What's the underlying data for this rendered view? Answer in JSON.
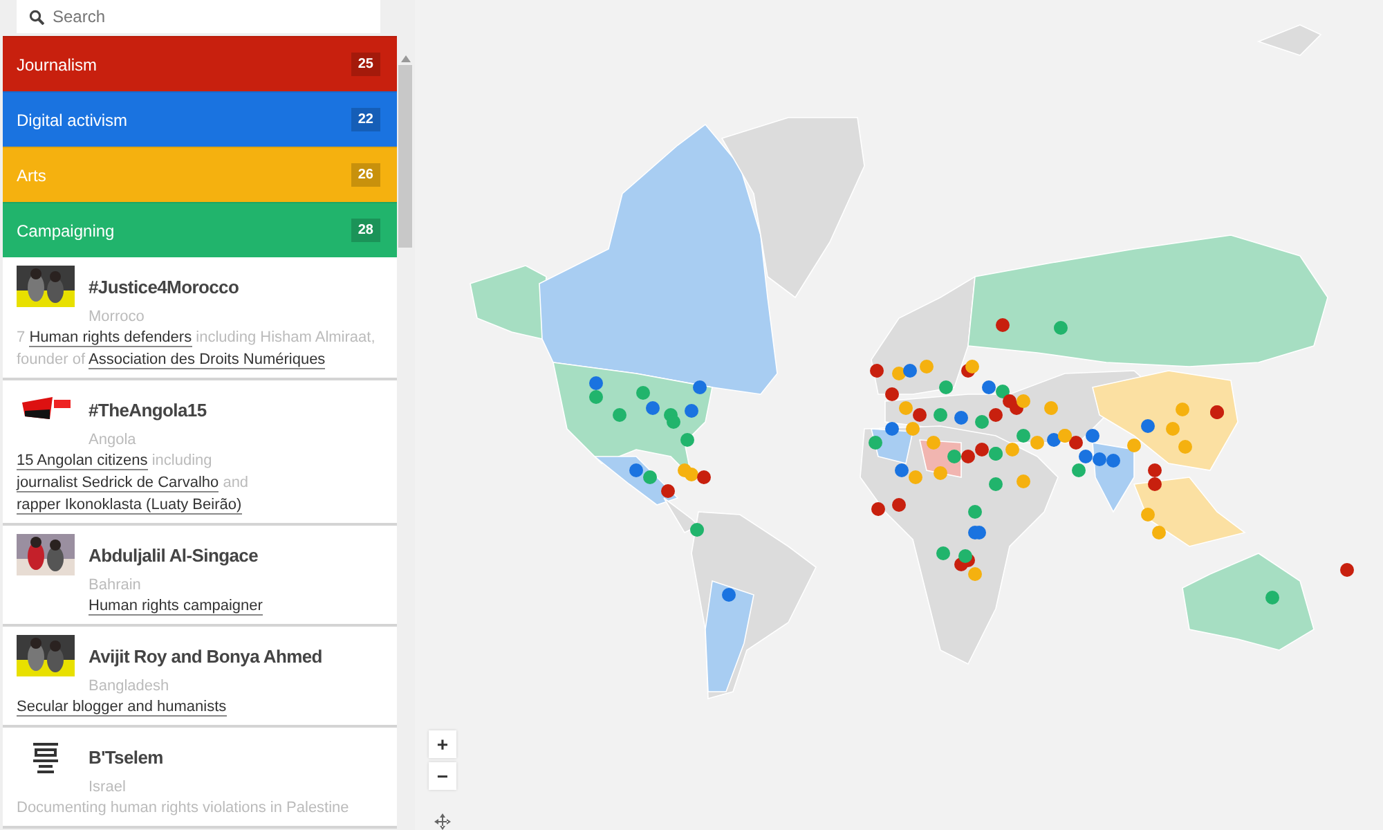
{
  "search": {
    "placeholder": "Search"
  },
  "categories": [
    {
      "label": "Journalism",
      "count": "25",
      "color": "#c8200e"
    },
    {
      "label": "Digital activism",
      "count": "22",
      "color": "#1a73e0"
    },
    {
      "label": "Arts",
      "count": "26",
      "color": "#f5b10f"
    },
    {
      "label": "Campaigning",
      "count": "28",
      "color": "#21b46c"
    }
  ],
  "stories": [
    {
      "title": "#Justice4Morocco",
      "country": "Morroco",
      "kind": "picture",
      "description": [
        {
          "text": "7 ",
          "link": false
        },
        {
          "text": "Human rights defenders",
          "link": true
        },
        {
          "text": " including Hisham Almiraat, founder of ",
          "link": false
        },
        {
          "text": "Association des Droits Numériques",
          "link": true
        }
      ]
    },
    {
      "title": "#TheAngola15",
      "country": "Angola",
      "kind": "logo",
      "description": [
        {
          "text": "15 Angolan citizens",
          "link": true
        },
        {
          "text": " including ",
          "link": false
        },
        {
          "text": "journalist Sedrick de Carvalho",
          "link": true
        },
        {
          "text": " and ",
          "link": false
        },
        {
          "text": "rapper Ikonoklasta (Luaty Beirão)",
          "link": true
        }
      ]
    },
    {
      "title": "Abduljalil Al-Singace",
      "country": "Bahrain",
      "kind": "picture",
      "description": [
        {
          "text": "Human rights campaigner",
          "link": true
        }
      ]
    },
    {
      "title": "Avijit Roy and Bonya Ahmed",
      "country": "Bangladesh",
      "kind": "picture",
      "description": [
        {
          "text": "Secular blogger and humanists",
          "link": true
        }
      ]
    },
    {
      "title": "B'Tselem",
      "country": "Israel",
      "kind": "emblem",
      "description": [
        {
          "text": "Documenting human rights violations in Palestine",
          "link": false
        }
      ]
    }
  ],
  "map": {
    "zoom_in": "+",
    "zoom_out": "−"
  }
}
